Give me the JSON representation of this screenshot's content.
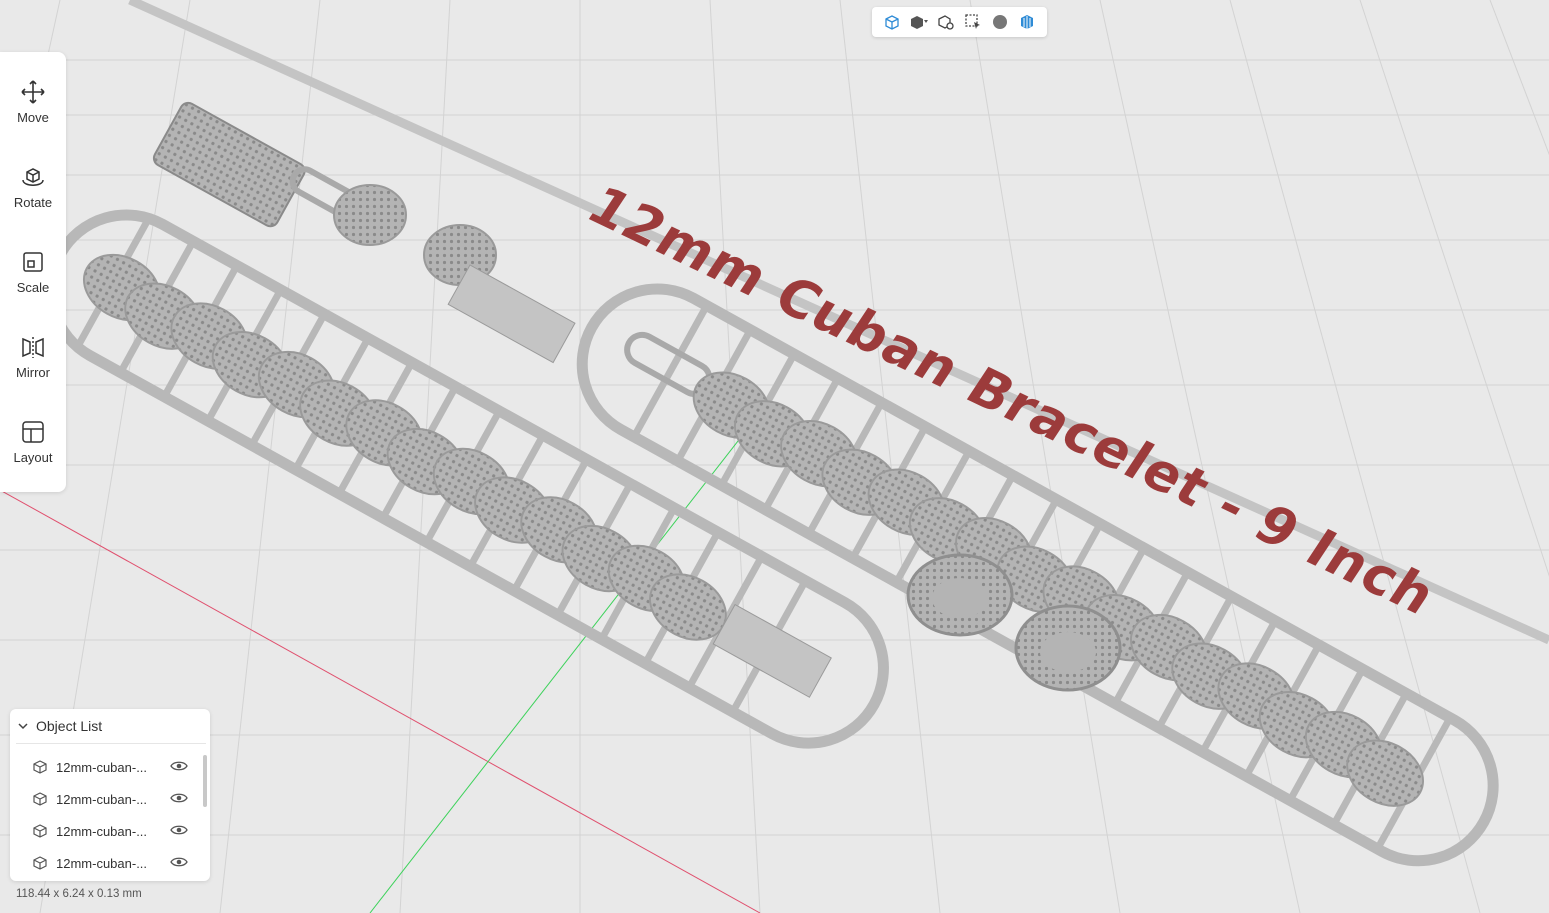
{
  "viewport": {
    "model_label": "12mm Cuban Bracelet - 9 Inch",
    "dimensions": "118.44 x 6.24 x 0.13 mm"
  },
  "top_toolbar": {
    "icons": [
      "view-cube-icon",
      "shading-mode-icon",
      "zoom-object-icon",
      "select-region-icon",
      "material-sphere-icon",
      "wireframe-icon"
    ]
  },
  "left_toolbar": {
    "tools": [
      {
        "label": "Move",
        "icon": "move-icon"
      },
      {
        "label": "Rotate",
        "icon": "rotate-icon"
      },
      {
        "label": "Scale",
        "icon": "scale-icon"
      },
      {
        "label": "Mirror",
        "icon": "mirror-icon"
      },
      {
        "label": "Layout",
        "icon": "layout-icon"
      }
    ]
  },
  "object_list": {
    "title": "Object List",
    "items": [
      {
        "name": "12mm-cuban-..."
      },
      {
        "name": "12mm-cuban-..."
      },
      {
        "name": "12mm-cuban-..."
      },
      {
        "name": "12mm-cuban-..."
      }
    ]
  },
  "colors": {
    "background": "#e9e9e9",
    "grid": "#d2d2d2",
    "plate_edge": "#c8c8c8",
    "model": "#b8b8b8",
    "label": "#9c3b3b",
    "x_axis": "#e0506e",
    "y_axis": "#3cd25a",
    "accent": "#2e8bd6"
  }
}
